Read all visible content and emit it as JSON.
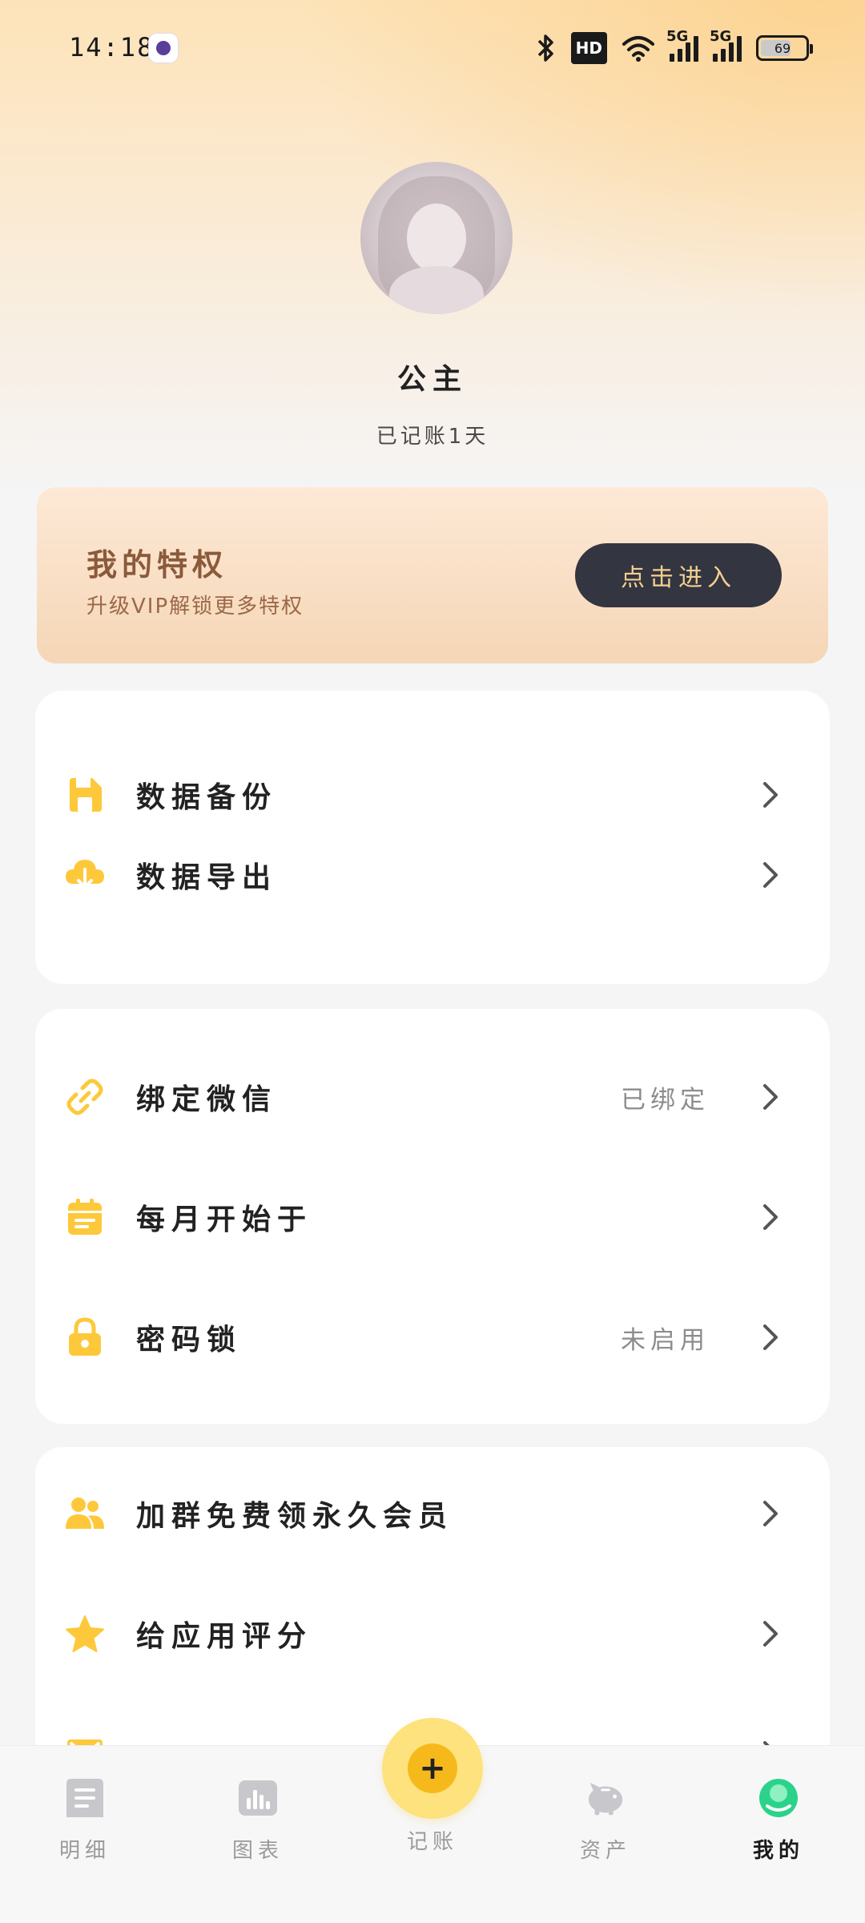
{
  "status_bar": {
    "time": "14:18",
    "network": "5G",
    "hd_label": "HD",
    "battery": "69",
    "battery_level": 0.69
  },
  "profile": {
    "name": "公主",
    "record_days": "已记账1天"
  },
  "vip": {
    "title": "我的特权",
    "subtitle": "升级VIP解锁更多特权",
    "button": "点击进入"
  },
  "groups": [
    {
      "items": [
        {
          "label": "数据备份",
          "icon": "floppy-icon"
        },
        {
          "label": "数据导出",
          "icon": "cloud-download-icon"
        }
      ]
    },
    {
      "items": [
        {
          "label": "绑定微信",
          "status": "已绑定",
          "icon": "link-icon"
        },
        {
          "label": "每月开始于",
          "icon": "calendar-icon"
        },
        {
          "label": "密码锁",
          "status": "未启用",
          "icon": "lock-icon"
        }
      ]
    },
    {
      "items": [
        {
          "label": "加群免费领永久会员",
          "icon": "group-icon"
        },
        {
          "label": "给应用评分",
          "icon": "star-icon"
        },
        {
          "label": "",
          "icon": "mail-icon"
        }
      ]
    }
  ],
  "bottom_nav": [
    {
      "label": "明细",
      "icon": "list-icon"
    },
    {
      "label": "图表",
      "icon": "chart-icon"
    },
    {
      "label": "记账",
      "icon": "plus-icon"
    },
    {
      "label": "资产",
      "icon": "piggy-bank-icon"
    },
    {
      "label": "我的",
      "icon": "profile-icon",
      "active": true
    }
  ],
  "colors": {
    "accent": "#FDC83A",
    "vip_button": "#333541",
    "vip_text": "#8A5A3A"
  }
}
